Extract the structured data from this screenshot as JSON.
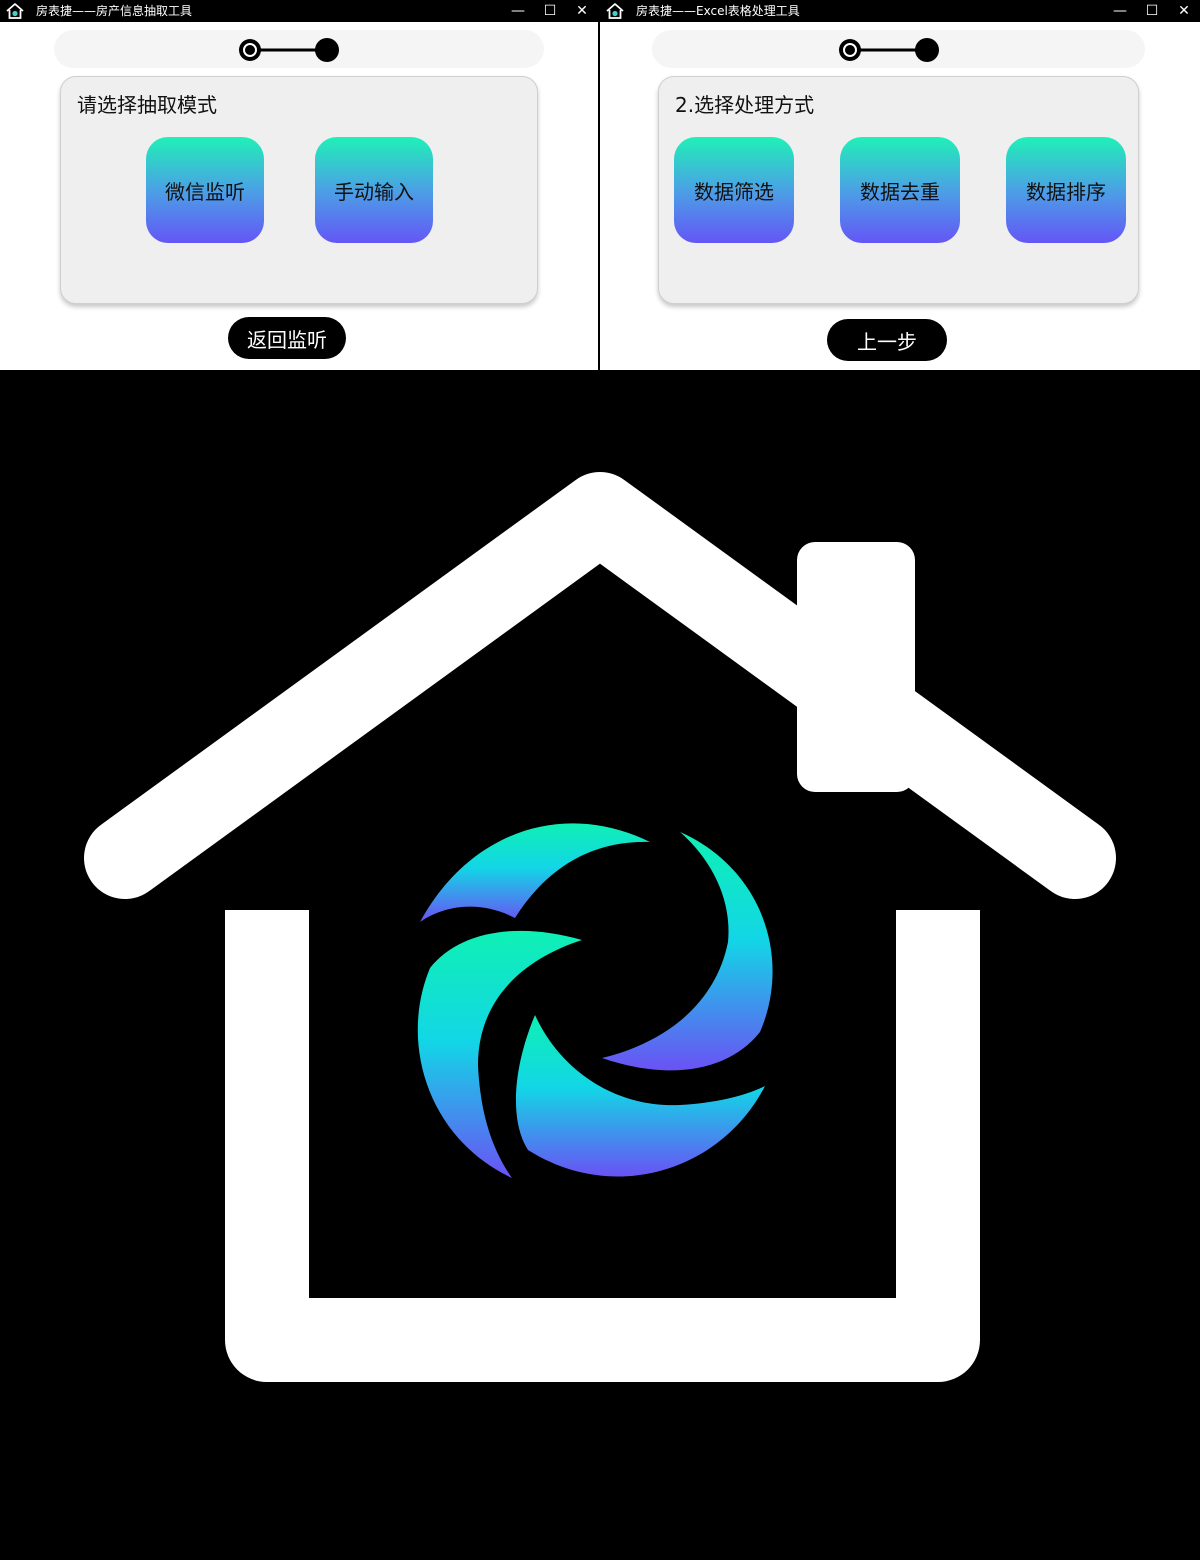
{
  "colors": {
    "titlebar": "#000000",
    "window_bg": "#ffffff",
    "panel_bg": "#efefef",
    "button_gradient_top": "#20f0b8",
    "button_gradient_bottom": "#6456f6",
    "pill_button": "#000000",
    "logo_bg": "#000000",
    "logo_house": "#ffffff",
    "logo_swirl_top": "#0ff0b4",
    "logo_swirl_bottom": "#6a52f4"
  },
  "window_left": {
    "title": "房表捷——房产信息抽取工具",
    "icon": "house-icon",
    "controls": {
      "minimize": "—",
      "maximize": "☐",
      "close": "✕"
    },
    "stepper": {
      "icon": "step-progress-icon",
      "current_step": 1,
      "total_steps": 2
    },
    "panel": {
      "label": "请选择抽取模式",
      "buttons": [
        "微信监听",
        "手动输入"
      ]
    },
    "footer_button": "返回监听"
  },
  "window_right": {
    "title": "房表捷——Excel表格处理工具",
    "icon": "house-icon",
    "controls": {
      "minimize": "—",
      "maximize": "☐",
      "close": "✕"
    },
    "stepper": {
      "icon": "step-progress-icon",
      "current_step": 1,
      "total_steps": 2
    },
    "panel": {
      "label": "2.选择处理方式",
      "buttons": [
        "数据筛选",
        "数据去重",
        "数据排序"
      ]
    },
    "footer_button": "上一步"
  },
  "logo": {
    "icon": "house-swirl-logo-icon"
  }
}
